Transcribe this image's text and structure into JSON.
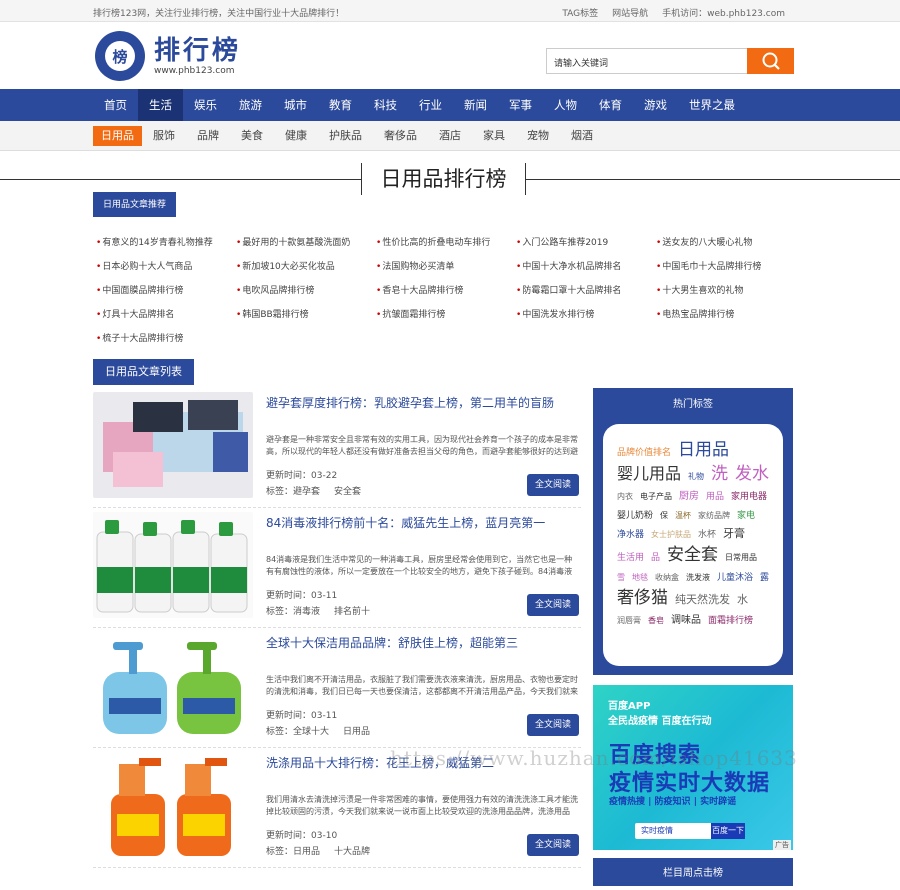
{
  "topbar": {
    "tip": "排行榜123网，关注行业排行榜，关注中国行业十大品牌排行！",
    "links": [
      "TAG标签",
      "网站导航",
      "手机访问：web.phb123.com"
    ]
  },
  "logo": {
    "mark": "榜",
    "name": "排行榜",
    "url": "www.phb123.com"
  },
  "search": {
    "placeholder": "请输入关键词",
    "icon": "search-icon"
  },
  "nav": [
    "首页",
    "生活",
    "娱乐",
    "旅游",
    "城市",
    "教育",
    "科技",
    "行业",
    "新闻",
    "军事",
    "人物",
    "体育",
    "游戏",
    "世界之最"
  ],
  "nav_active": 1,
  "subnav": [
    "日用品",
    "服饰",
    "品牌",
    "美食",
    "健康",
    "护肤品",
    "奢侈品",
    "酒店",
    "家具",
    "宠物",
    "烟酒"
  ],
  "subnav_active": 0,
  "page_title": "日用品排行榜",
  "rec": {
    "tab": "日用品文章推荐",
    "items": [
      "有意义的14岁青春礼物推荐",
      "最好用的十款氨基酸洗面奶",
      "性价比高的折叠电动车排行",
      "入门公路车推荐2019",
      "送女友的八大暖心礼物",
      "日本必购十大人气商品",
      "新加坡10大必买化妆品",
      "法国购物必买清单",
      "中国十大净水机品牌排名",
      "中国毛巾十大品牌排行榜",
      "中国面膜品牌排行榜",
      "电吹风品牌排行榜",
      "香皂十大品牌排行榜",
      "防霉霜口罩十大品牌排名",
      "十大男生喜欢的礼物",
      "灯具十大品牌排名",
      "韩国BB霜排行榜",
      "抗皱面霜排行榜",
      "中国洗发水排行榜",
      "电热宝品牌排行榜",
      "梳子十大品牌排行榜"
    ]
  },
  "list": {
    "tab": "日用品文章列表",
    "read_label": "全文阅读",
    "time_label": "更新时间：",
    "tags_label": "标签：",
    "articles": [
      {
        "title": "避孕套厚度排行榜：乳胶避孕套上榜，第二用羊的盲肠",
        "desc": "避孕套是一种非常安全且非常有效的实用工具，因为现代社会养育一个孩子的成本是非常高，所以现代的年轻人都还没有做好准备去担当父母的角色，而避孕套能够很好的达到避",
        "time": "03-22",
        "tags": [
          "避孕套",
          "安全套"
        ]
      },
      {
        "title": "84消毒液排行榜前十名：威猛先生上榜，蓝月亮第一",
        "desc": "84消毒液是我们生活中常见的一种消毒工具，厨房里经常会使用到它，当然它也是一种有有腐蚀性的液体，所以一定要放在一个比较安全的地方，避免下孩子碰到。84消毒液",
        "time": "03-11",
        "tags": [
          "消毒液",
          "排名前十"
        ]
      },
      {
        "title": "全球十大保洁用品品牌：舒肤佳上榜，超能第三",
        "desc": "生活中我们离不开清洁用品，衣服脏了我们需要洗衣液来清洗，厨房用品、衣物也要定时的清洗和消毒，我们日已每一天也要保清洁，这都都离不开清洁用品产品，今天我们就来说",
        "time": "03-11",
        "tags": [
          "全球十大",
          "日用品"
        ]
      },
      {
        "title": "洗涤用品十大排行榜：花王上榜，威猛第二",
        "desc": "我们用清水去清洗掉污渍是一件非常困难的事情，要使用强力有效的清洗洗涤工具才能洗掉比较顽固的污渍，今天我们就来说一说市面上比较受欢迎的洗涤用品品牌，洗涤用品",
        "time": "03-10",
        "tags": [
          "日用品",
          "十大品牌"
        ]
      }
    ]
  },
  "hot_tags": {
    "title": "热门标签",
    "tags": [
      {
        "t": "品牌价值排名",
        "c": "#e8883a",
        "s": 9
      },
      {
        "t": "日用品",
        "c": "#2c4a9b",
        "s": 17
      },
      {
        "t": "婴儿用品",
        "c": "#333",
        "s": 16
      },
      {
        "t": "礼物",
        "c": "#2c4a9b",
        "s": 8
      },
      {
        "t": "洗",
        "c": "#c060c0",
        "s": 17
      },
      {
        "t": "发水",
        "c": "#c060c0",
        "s": 17
      },
      {
        "t": "内衣",
        "c": "#666",
        "s": 8
      },
      {
        "t": "电子产品",
        "c": "#333",
        "s": 8
      },
      {
        "t": "厨房",
        "c": "#c060c0",
        "s": 10
      },
      {
        "t": "用品",
        "c": "#c060c0",
        "s": 9
      },
      {
        "t": "家用电器",
        "c": "#8a2a6a",
        "s": 9
      },
      {
        "t": "婴儿奶粉",
        "c": "#333",
        "s": 9
      },
      {
        "t": "保",
        "c": "#333",
        "s": 8
      },
      {
        "t": "温杯",
        "c": "#8a6a2a",
        "s": 8
      },
      {
        "t": "家纺品牌",
        "c": "#666",
        "s": 8
      },
      {
        "t": "家电",
        "c": "#3a9a4a",
        "s": 9
      },
      {
        "t": "净水器",
        "c": "#2c4a9b",
        "s": 9
      },
      {
        "t": "女士护肤品",
        "c": "#c8a878",
        "s": 8
      },
      {
        "t": "水杯",
        "c": "#666",
        "s": 9
      },
      {
        "t": "牙膏",
        "c": "#333",
        "s": 11
      },
      {
        "t": "生活用",
        "c": "#c060c0",
        "s": 9
      },
      {
        "t": "品",
        "c": "#c060c0",
        "s": 9
      },
      {
        "t": "安全套",
        "c": "#333",
        "s": 17
      },
      {
        "t": "日常用品",
        "c": "#333",
        "s": 8
      },
      {
        "t": "雪",
        "c": "#c060c0",
        "s": 8
      },
      {
        "t": "地毯",
        "c": "#c060c0",
        "s": 8
      },
      {
        "t": "收纳盒",
        "c": "#666",
        "s": 8
      },
      {
        "t": "洗发液",
        "c": "#333",
        "s": 8
      },
      {
        "t": "儿童沐浴",
        "c": "#2c4a9b",
        "s": 9
      },
      {
        "t": "露",
        "c": "#2c4a9b",
        "s": 9
      },
      {
        "t": "奢侈猫",
        "c": "#333",
        "s": 17
      },
      {
        "t": "纯天然洗发",
        "c": "#666",
        "s": 11
      },
      {
        "t": "水",
        "c": "#666",
        "s": 11
      },
      {
        "t": "润唇膏",
        "c": "#666",
        "s": 8
      },
      {
        "t": "香皂",
        "c": "#8a2a6a",
        "s": 8
      },
      {
        "t": "调味品",
        "c": "#333",
        "s": 10
      },
      {
        "t": "面霜排行榜",
        "c": "#8a2a6a",
        "s": 9
      }
    ]
  },
  "ad": {
    "brand": "百度APP",
    "slogan": "全民战疫情 百度在行动",
    "big1": "百度搜索",
    "big2": "疫情实时大数据",
    "sub": "疫情热搜 | 防疫知识 | 实时辟谣",
    "search": "实时疫情",
    "search_btn": "百度一下",
    "tag": "广告"
  },
  "weekly": "栏目周点击榜",
  "watermark": "https://www.huzhan.com/ishop41633"
}
